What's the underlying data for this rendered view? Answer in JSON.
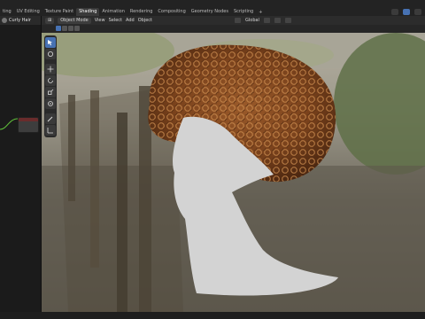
{
  "workspace_tabs": [
    "ting",
    "UV Editing",
    "Texture Paint",
    "Shading",
    "Animation",
    "Rendering",
    "Compositing",
    "Geometry Nodes",
    "Scripting"
  ],
  "active_tab_index": 3,
  "add_tab": "+",
  "node_editor": {
    "object_name": "Curly Hair"
  },
  "viewport_header": {
    "mode": "Object Mode",
    "menu": [
      "View",
      "Select",
      "Add",
      "Object"
    ],
    "orientation": "Global"
  },
  "colors": {
    "accent": "#4772b3",
    "node_header": "#6a2c2c",
    "wire": "#5fbf3a"
  },
  "toolbar_icons": [
    "select-box-icon",
    "cursor-icon",
    "move-icon",
    "rotate-icon",
    "scale-icon",
    "transform-icon",
    "annotate-icon",
    "measure-icon"
  ]
}
